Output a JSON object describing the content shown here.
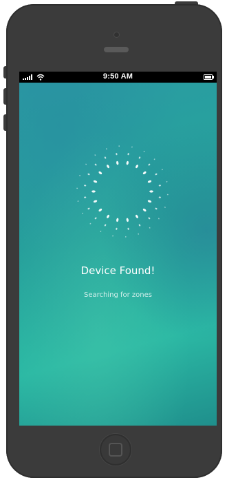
{
  "status_bar": {
    "time": "9:50 AM",
    "signal_icon": "signal-bars-icon",
    "wifi_icon": "wifi-icon",
    "battery_icon": "battery-icon"
  },
  "main": {
    "title": "Device Found!",
    "subtitle": "Searching for zones",
    "spinner_icon": "loading-dots-ring-icon"
  },
  "colors": {
    "screen_teal": "#25a59a",
    "screen_blue": "#2b8fa8",
    "text": "#ffffff",
    "device_body": "#3b3b3b"
  },
  "hardware": {
    "home_icon": "home-button-icon"
  }
}
